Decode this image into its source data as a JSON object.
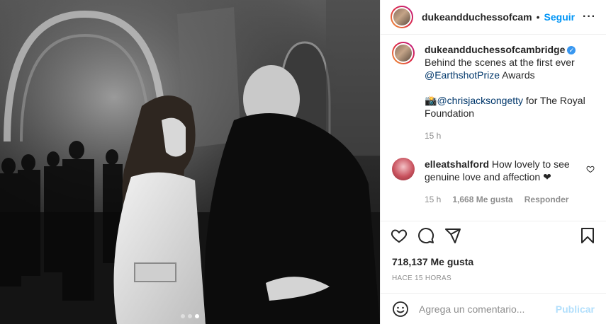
{
  "header": {
    "username": "dukeandduchessofcam",
    "separator": "•",
    "follow_label": "Seguir",
    "more_label": "···"
  },
  "caption": {
    "username": "dukeandduchessofcambridge",
    "verified_mark": "✓",
    "line1": "Behind the scenes at the first ever",
    "mention1": "@EarthshotPrize",
    "line1_end": "Awards",
    "camera_emoji": "📸",
    "mention2": "@chrisjacksongetty",
    "line2_end": "for The Royal Foundation",
    "time": "15 h"
  },
  "comment": {
    "username": "elleatshalford",
    "text": "How lovely to see genuine love and affection ❤",
    "time": "15 h",
    "likes": "1,668 Me gusta",
    "reply": "Responder"
  },
  "likes_label": "718,137 Me gusta",
  "posted_ago": "HACE 15 HORAS",
  "add_comment": {
    "placeholder": "Agrega un comentario...",
    "post_label": "Publicar"
  },
  "carousel": {
    "count": 3,
    "active": 2
  },
  "colors": {
    "follow": "#0095f6",
    "publish_disabled": "#b2dffc",
    "link": "#00376b"
  }
}
